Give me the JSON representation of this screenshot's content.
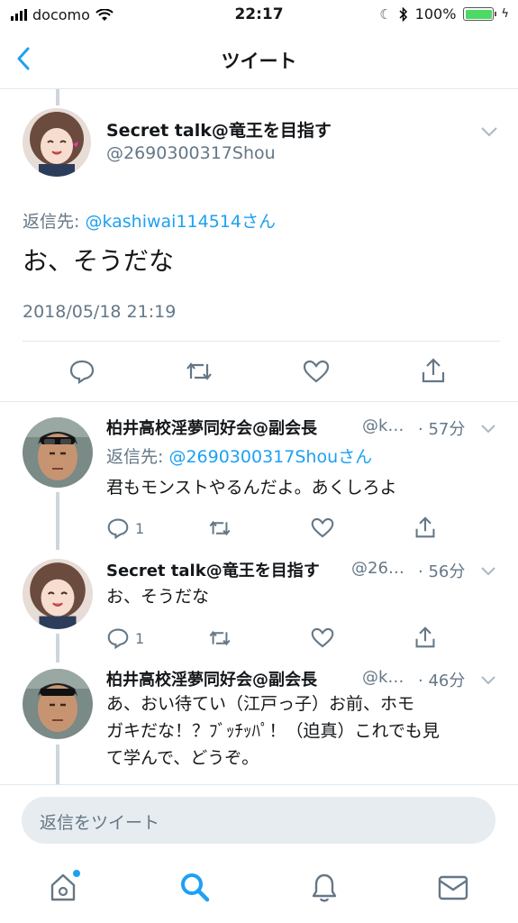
{
  "status": {
    "carrier": "docomo",
    "time": "22:17",
    "battery": "100%"
  },
  "nav": {
    "title": "ツイート"
  },
  "main_tweet": {
    "name": "Secret talk@竜王を目指す",
    "handle": "@2690300317Shou",
    "reply_label": "返信先: ",
    "reply_mention": "@kashiwai114514さん",
    "text": "お、そうだな",
    "date": "2018/05/18 21:19"
  },
  "replies": [
    {
      "name": "柏井高校淫夢同好会@副会長",
      "handle": "@k…",
      "age": "· 57分",
      "reply_label": "返信先: ",
      "reply_mention": "@2690300317Shouさん",
      "text": "君もモンストやるんだよ。あくしろよ",
      "reply_count": "1"
    },
    {
      "name": "Secret talk@竜王を目指す",
      "handle": "@26…",
      "age": "· 56分",
      "text": "お、そうだな",
      "reply_count": "1"
    },
    {
      "name": "柏井高校淫夢同好会@副会長",
      "handle": "@k…",
      "age": "· 46分",
      "text_lines": [
        "あ、おい待てい（江戸っ子）お前、ホモ",
        "ガキだな！？ﾌﾞｯﾁｯﾊﾟ！（迫真）これでも見",
        "て学んで、どうぞ。"
      ]
    }
  ],
  "reply_box": {
    "placeholder": "返信をツイート"
  },
  "tabs": [
    "home-icon",
    "search-icon",
    "notifications-icon",
    "messages-icon"
  ],
  "colors": {
    "accent": "#1da1f2",
    "muted": "#657786",
    "divider": "#e1e8ed",
    "battery": "#4cd964"
  }
}
